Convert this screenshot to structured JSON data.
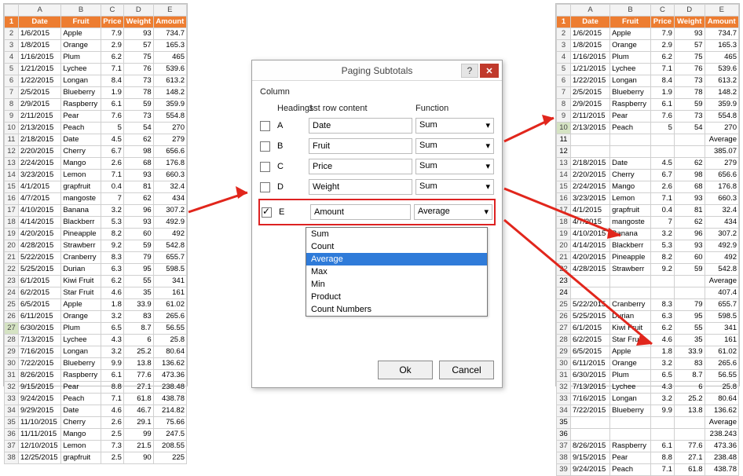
{
  "col_labels": [
    "A",
    "B",
    "C",
    "D",
    "E"
  ],
  "row_headers": [
    "Date",
    "Fruit",
    "Price",
    "Weight",
    "Amount"
  ],
  "left_rows": [
    [
      "1/6/2015",
      "Apple",
      "7.9",
      "93",
      "734.7"
    ],
    [
      "1/8/2015",
      "Orange",
      "2.9",
      "57",
      "165.3"
    ],
    [
      "1/16/2015",
      "Plum",
      "6.2",
      "75",
      "465"
    ],
    [
      "1/21/2015",
      "Lychee",
      "7.1",
      "76",
      "539.6"
    ],
    [
      "1/22/2015",
      "Longan",
      "8.4",
      "73",
      "613.2"
    ],
    [
      "2/5/2015",
      "Blueberry",
      "1.9",
      "78",
      "148.2"
    ],
    [
      "2/9/2015",
      "Raspberry",
      "6.1",
      "59",
      "359.9"
    ],
    [
      "2/11/2015",
      "Pear",
      "7.6",
      "73",
      "554.8"
    ],
    [
      "2/13/2015",
      "Peach",
      "5",
      "54",
      "270"
    ],
    [
      "2/18/2015",
      "Date",
      "4.5",
      "62",
      "279"
    ],
    [
      "2/20/2015",
      "Cherry",
      "6.7",
      "98",
      "656.6"
    ],
    [
      "2/24/2015",
      "Mango",
      "2.6",
      "68",
      "176.8"
    ],
    [
      "3/23/2015",
      "Lemon",
      "7.1",
      "93",
      "660.3"
    ],
    [
      "4/1/2015",
      "grapfruit",
      "0.4",
      "81",
      "32.4"
    ],
    [
      "4/7/2015",
      "mangoste",
      "7",
      "62",
      "434"
    ],
    [
      "4/10/2015",
      "Banana",
      "3.2",
      "96",
      "307.2"
    ],
    [
      "4/14/2015",
      "Blackberr",
      "5.3",
      "93",
      "492.9"
    ],
    [
      "4/20/2015",
      "Pineapple",
      "8.2",
      "60",
      "492"
    ],
    [
      "4/28/2015",
      "Strawberr",
      "9.2",
      "59",
      "542.8"
    ],
    [
      "5/22/2015",
      "Cranberry",
      "8.3",
      "79",
      "655.7"
    ],
    [
      "5/25/2015",
      "Durian",
      "6.3",
      "95",
      "598.5"
    ],
    [
      "6/1/2015",
      "Kiwi Fruit",
      "6.2",
      "55",
      "341"
    ],
    [
      "6/2/2015",
      "Star Fruit",
      "4.6",
      "35",
      "161"
    ],
    [
      "6/5/2015",
      "Apple",
      "1.8",
      "33.9",
      "61.02"
    ],
    [
      "6/11/2015",
      "Orange",
      "3.2",
      "83",
      "265.6"
    ],
    [
      "6/30/2015",
      "Plum",
      "6.5",
      "8.7",
      "56.55"
    ],
    [
      "7/13/2015",
      "Lychee",
      "4.3",
      "6",
      "25.8"
    ],
    [
      "7/16/2015",
      "Longan",
      "3.2",
      "25.2",
      "80.64"
    ],
    [
      "7/22/2015",
      "Blueberry",
      "9.9",
      "13.8",
      "136.62"
    ],
    [
      "8/26/2015",
      "Raspberry",
      "6.1",
      "77.6",
      "473.36"
    ],
    [
      "9/15/2015",
      "Pear",
      "8.8",
      "27.1",
      "238.48"
    ],
    [
      "9/24/2015",
      "Peach",
      "7.1",
      "61.8",
      "438.78"
    ],
    [
      "9/29/2015",
      "Date",
      "4.6",
      "46.7",
      "214.82"
    ],
    [
      "11/10/2015",
      "Cherry",
      "2.6",
      "29.1",
      "75.66"
    ],
    [
      "11/11/2015",
      "Mango",
      "2.5",
      "99",
      "247.5"
    ],
    [
      "12/10/2015",
      "Lemon",
      "7.3",
      "21.5",
      "208.55"
    ],
    [
      "12/25/2015",
      "grapfruit",
      "2.5",
      "90",
      "225"
    ]
  ],
  "right_rows": [
    {
      "r": 2,
      "d": [
        "1/6/2015",
        "Apple",
        "7.9",
        "93",
        "734.7"
      ]
    },
    {
      "r": 3,
      "d": [
        "1/8/2015",
        "Orange",
        "2.9",
        "57",
        "165.3"
      ]
    },
    {
      "r": 4,
      "d": [
        "1/16/2015",
        "Plum",
        "6.2",
        "75",
        "465"
      ]
    },
    {
      "r": 5,
      "d": [
        "1/21/2015",
        "Lychee",
        "7.1",
        "76",
        "539.6"
      ]
    },
    {
      "r": 6,
      "d": [
        "1/22/2015",
        "Longan",
        "8.4",
        "73",
        "613.2"
      ]
    },
    {
      "r": 7,
      "d": [
        "2/5/2015",
        "Blueberry",
        "1.9",
        "78",
        "148.2"
      ]
    },
    {
      "r": 8,
      "d": [
        "2/9/2015",
        "Raspberry",
        "6.1",
        "59",
        "359.9"
      ]
    },
    {
      "r": 9,
      "d": [
        "2/11/2015",
        "Pear",
        "7.6",
        "73",
        "554.8"
      ]
    },
    {
      "r": 10,
      "d": [
        "2/13/2015",
        "Peach",
        "5",
        "54",
        "270"
      ],
      "sel": true
    },
    {
      "r": 11,
      "avg": true,
      "label": "Average"
    },
    {
      "r": 12,
      "avg": true,
      "val": "385.07"
    },
    {
      "r": 13,
      "d": [
        "2/18/2015",
        "Date",
        "4.5",
        "62",
        "279"
      ]
    },
    {
      "r": 14,
      "d": [
        "2/20/2015",
        "Cherry",
        "6.7",
        "98",
        "656.6"
      ]
    },
    {
      "r": 15,
      "d": [
        "2/24/2015",
        "Mango",
        "2.6",
        "68",
        "176.8"
      ]
    },
    {
      "r": 16,
      "d": [
        "3/23/2015",
        "Lemon",
        "7.1",
        "93",
        "660.3"
      ]
    },
    {
      "r": 17,
      "d": [
        "4/1/2015",
        "grapfruit",
        "0.4",
        "81",
        "32.4"
      ]
    },
    {
      "r": 18,
      "d": [
        "4/7/2015",
        "mangoste",
        "7",
        "62",
        "434"
      ]
    },
    {
      "r": 19,
      "d": [
        "4/10/2015",
        "Banana",
        "3.2",
        "96",
        "307.2"
      ]
    },
    {
      "r": 20,
      "d": [
        "4/14/2015",
        "Blackberr",
        "5.3",
        "93",
        "492.9"
      ]
    },
    {
      "r": 21,
      "d": [
        "4/20/2015",
        "Pineapple",
        "8.2",
        "60",
        "492"
      ]
    },
    {
      "r": 22,
      "d": [
        "4/28/2015",
        "Strawberr",
        "9.2",
        "59",
        "542.8"
      ]
    },
    {
      "r": 23,
      "avg": true,
      "label": "Average"
    },
    {
      "r": 24,
      "avg": true,
      "val": "407.4"
    },
    {
      "r": 25,
      "d": [
        "5/22/2015",
        "Cranberry",
        "8.3",
        "79",
        "655.7"
      ]
    },
    {
      "r": 26,
      "d": [
        "5/25/2015",
        "Durian",
        "6.3",
        "95",
        "598.5"
      ]
    },
    {
      "r": 27,
      "d": [
        "6/1/2015",
        "Kiwi Fruit",
        "6.2",
        "55",
        "341"
      ]
    },
    {
      "r": 28,
      "d": [
        "6/2/2015",
        "Star Fruit",
        "4.6",
        "35",
        "161"
      ]
    },
    {
      "r": 29,
      "d": [
        "6/5/2015",
        "Apple",
        "1.8",
        "33.9",
        "61.02"
      ]
    },
    {
      "r": 30,
      "d": [
        "6/11/2015",
        "Orange",
        "3.2",
        "83",
        "265.6"
      ]
    },
    {
      "r": 31,
      "d": [
        "6/30/2015",
        "Plum",
        "6.5",
        "8.7",
        "56.55"
      ]
    },
    {
      "r": 32,
      "d": [
        "7/13/2015",
        "Lychee",
        "4.3",
        "6",
        "25.8"
      ]
    },
    {
      "r": 33,
      "d": [
        "7/16/2015",
        "Longan",
        "3.2",
        "25.2",
        "80.64"
      ]
    },
    {
      "r": 34,
      "d": [
        "7/22/2015",
        "Blueberry",
        "9.9",
        "13.8",
        "136.62"
      ]
    },
    {
      "r": 35,
      "avg": true,
      "label": "Average"
    },
    {
      "r": 36,
      "avg": true,
      "val": "238.243"
    },
    {
      "r": 37,
      "d": [
        "8/26/2015",
        "Raspberry",
        "6.1",
        "77.6",
        "473.36"
      ]
    },
    {
      "r": 38,
      "d": [
        "9/15/2015",
        "Pear",
        "8.8",
        "27.1",
        "238.48"
      ]
    },
    {
      "r": 39,
      "d": [
        "9/24/2015",
        "Peach",
        "7.1",
        "61.8",
        "438.78"
      ]
    }
  ],
  "dialog": {
    "title": "Paging Subtotals",
    "column_label": "Column",
    "headings_label": "Headings",
    "content_label": "1st row content",
    "function_label": "Function",
    "rows": [
      {
        "checked": false,
        "col": "A",
        "content": "Date",
        "fn": "Sum"
      },
      {
        "checked": false,
        "col": "B",
        "content": "Fruit",
        "fn": "Sum"
      },
      {
        "checked": false,
        "col": "C",
        "content": "Price",
        "fn": "Sum"
      },
      {
        "checked": false,
        "col": "D",
        "content": "Weight",
        "fn": "Sum"
      },
      {
        "checked": true,
        "col": "E",
        "content": "Amount",
        "fn": "Average"
      }
    ],
    "dropdown_options": [
      "Sum",
      "Count",
      "Average",
      "Max",
      "Min",
      "Product",
      "Count Numbers"
    ],
    "dropdown_selected": "Average",
    "ok": "Ok",
    "cancel": "Cancel"
  }
}
